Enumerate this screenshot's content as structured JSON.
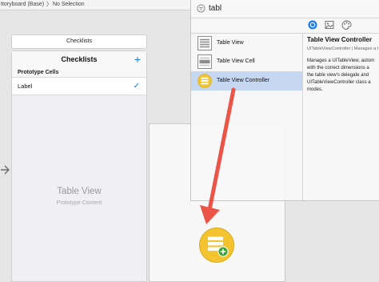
{
  "breadcrumb": {
    "storyboard": "ttoryboard (Base)",
    "separator": "〉",
    "selection": "No Selection"
  },
  "scene": {
    "title_bar": "Checklists",
    "nav_title": "Checklists",
    "nav_add_glyph": "+",
    "section_header": "Prototype Cells",
    "cell_label": "Label",
    "cell_accessory": "✓",
    "table_view_title": "Table View",
    "table_view_subtitle": "Prototype Content"
  },
  "library": {
    "search_text": "tabl",
    "items": [
      {
        "label": "Table View",
        "icon": "table-view-icon"
      },
      {
        "label": "Table View Cell",
        "icon": "table-view-cell-icon"
      },
      {
        "label": "Table View Controller",
        "icon": "table-view-controller-icon"
      }
    ],
    "detail": {
      "title": "Table View Controller",
      "class_line": "UITableViewController | Manages a t",
      "description": "Manages a UITableView, autom\nwith the correct dimensions a\nthe table view's delegate and\nUITableViewController class a\nmodes."
    }
  },
  "colors": {
    "accent": "#1a7cf5",
    "selection": "#c5d7f1",
    "arrow": "#ea5547",
    "controller_icon": "#f4c430"
  }
}
